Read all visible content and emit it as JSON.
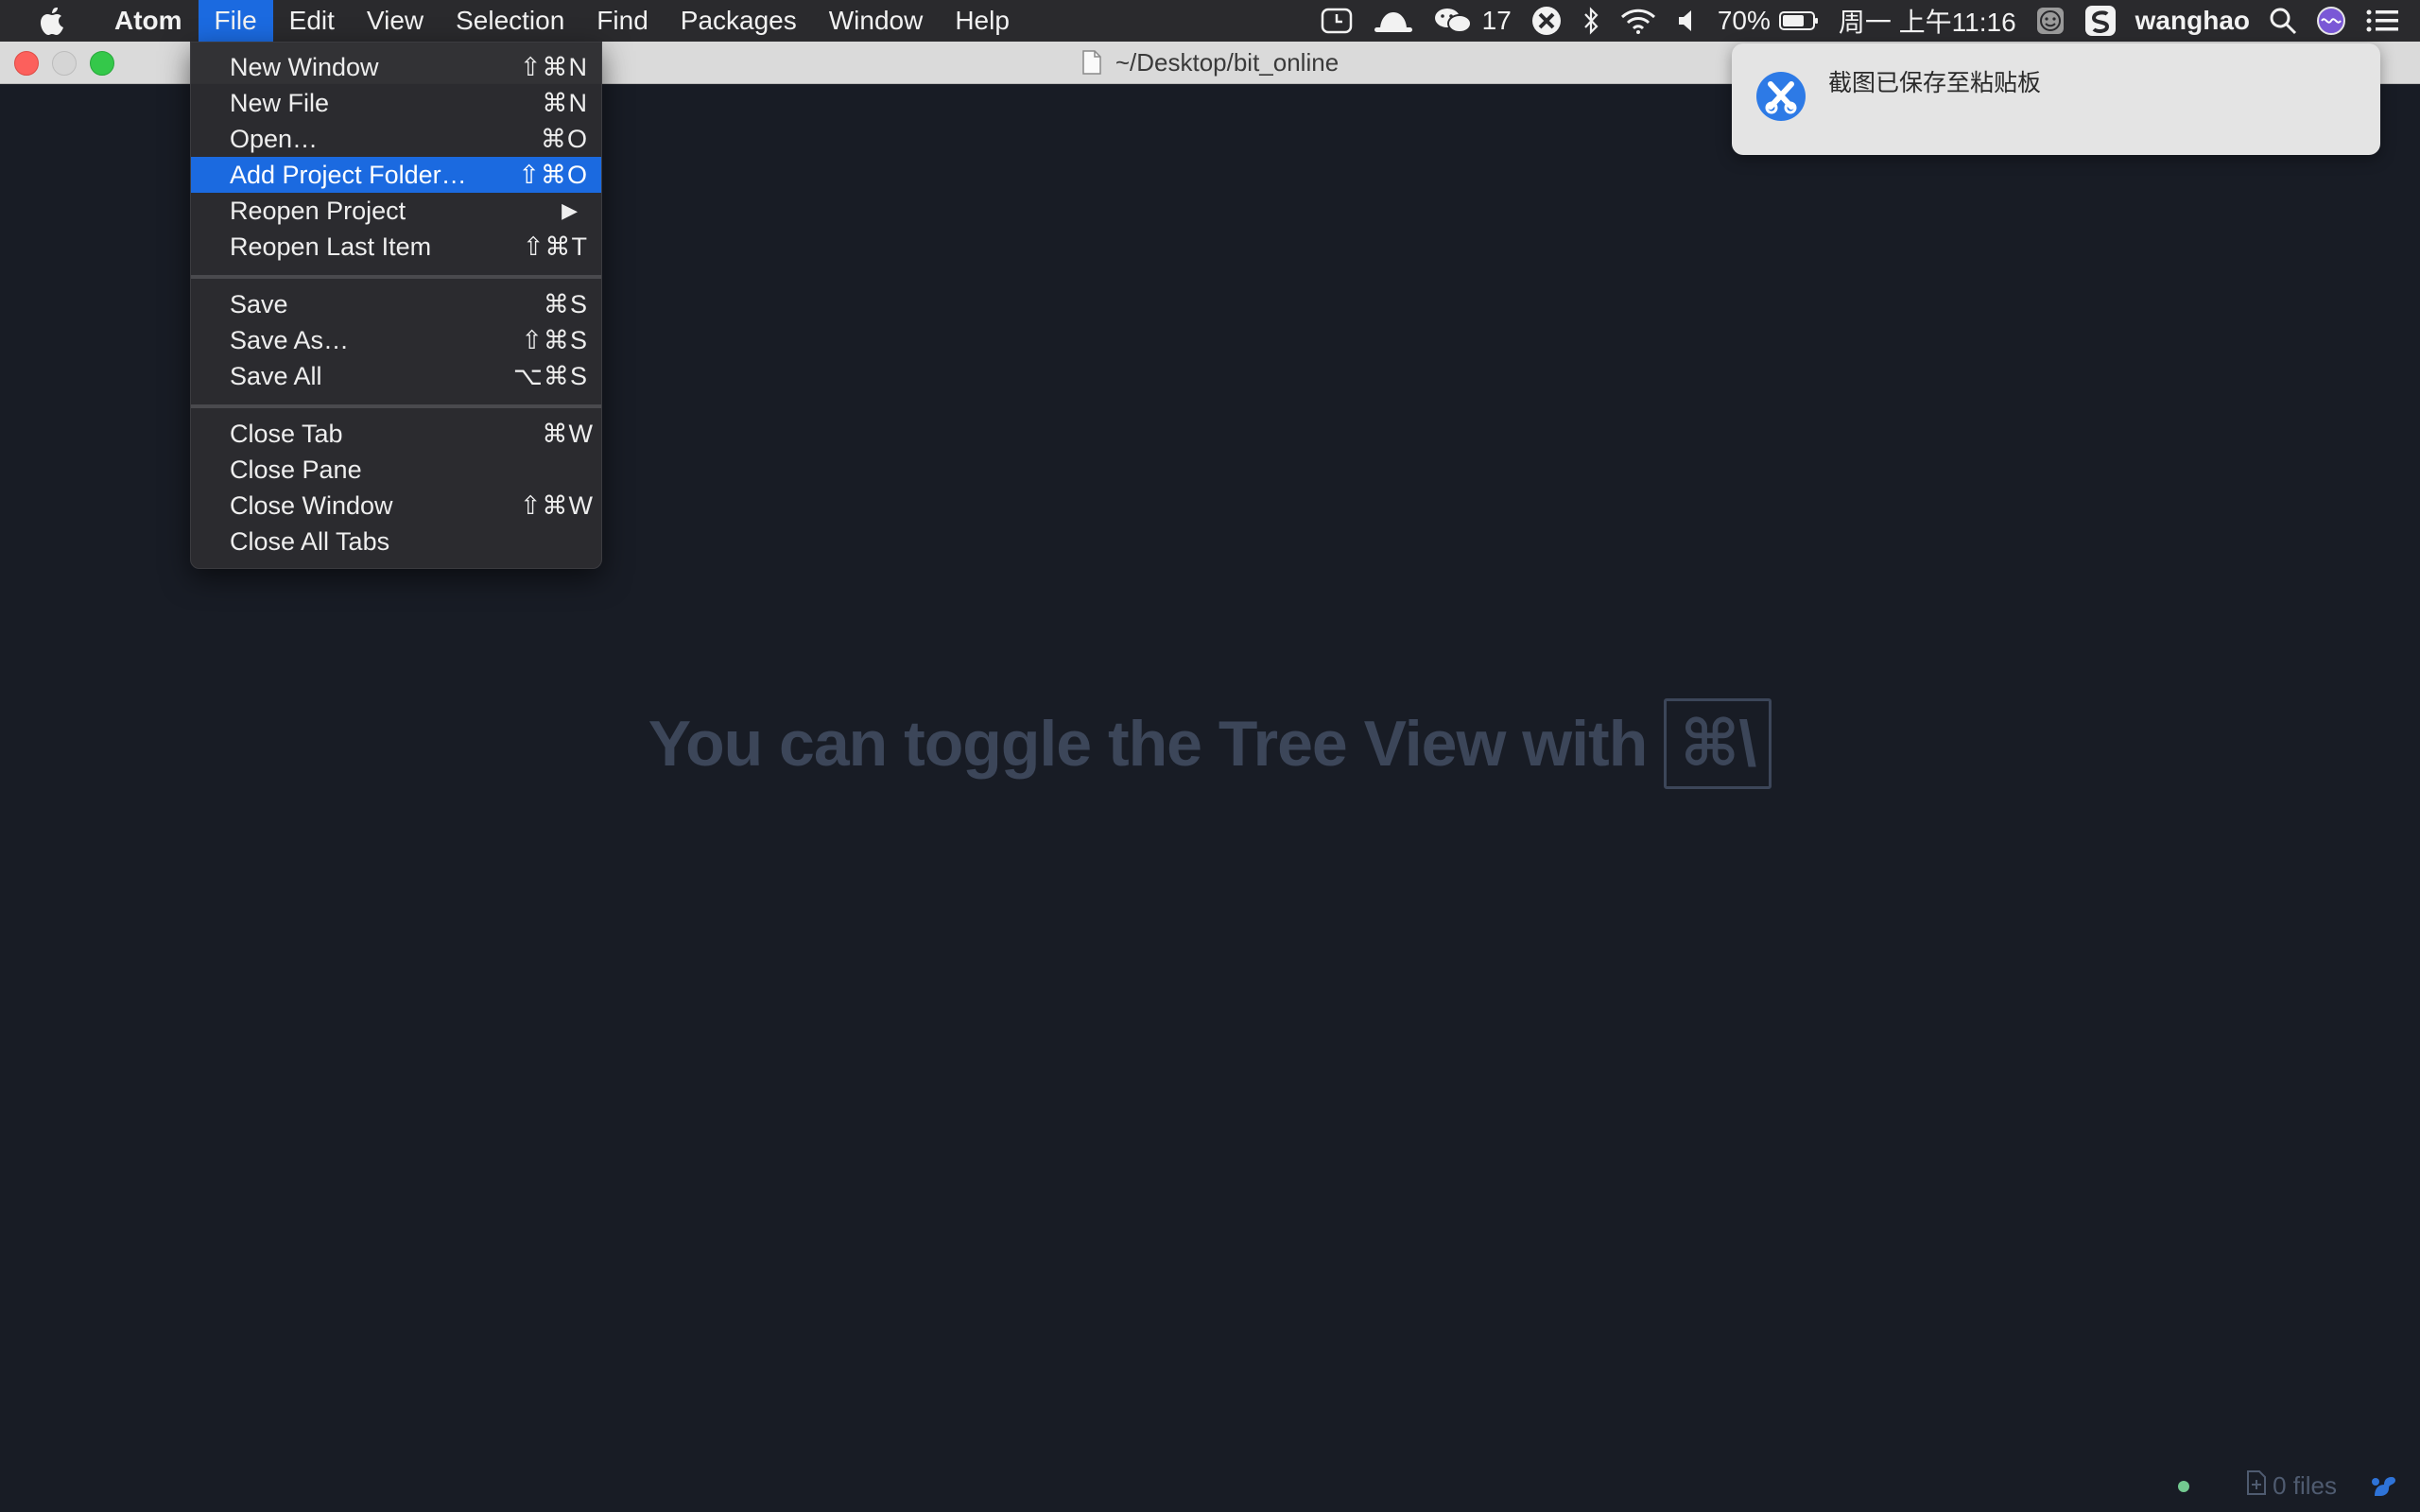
{
  "menubar": {
    "app_name": "Atom",
    "menus": [
      "File",
      "Edit",
      "View",
      "Selection",
      "Find",
      "Packages",
      "Window",
      "Help"
    ],
    "active_menu": "File",
    "status": {
      "wechat_count": "17",
      "battery": "70%",
      "datetime": "周一 上午11:16",
      "user": "wanghao"
    }
  },
  "window": {
    "title": "~/Desktop/bit_online"
  },
  "file_menu": {
    "items": [
      {
        "label": "New Window",
        "shortcut": "⇧⌘N"
      },
      {
        "label": "New File",
        "shortcut": "⌘N"
      },
      {
        "label": "Open…",
        "shortcut": "⌘O"
      },
      {
        "label": "Add Project Folder…",
        "shortcut": "⇧⌘O"
      },
      {
        "label": "Reopen Project",
        "shortcut": "▶"
      },
      {
        "label": "Reopen Last Item",
        "shortcut": "⇧⌘T"
      },
      {
        "label": "Save",
        "shortcut": "⌘S"
      },
      {
        "label": "Save As…",
        "shortcut": "⇧⌘S"
      },
      {
        "label": "Save All",
        "shortcut": "⌥⌘S"
      },
      {
        "label": "Close Tab",
        "shortcut": "⌘W"
      },
      {
        "label": "Close Pane",
        "shortcut": ""
      },
      {
        "label": "Close Window",
        "shortcut": "⇧⌘W"
      },
      {
        "label": "Close All Tabs",
        "shortcut": ""
      }
    ],
    "highlighted_index": 3
  },
  "workspace": {
    "hint_text": "You can toggle the Tree View with",
    "hint_key": "⌘\\"
  },
  "statusbar": {
    "files": "0 files"
  },
  "notification": {
    "message": "截图已保存至粘贴板"
  },
  "colors": {
    "menu_highlight": "#1b6ae0",
    "workspace_bg": "#181c25",
    "hint_text": "#3c4659",
    "git_dot": "#73c990"
  }
}
